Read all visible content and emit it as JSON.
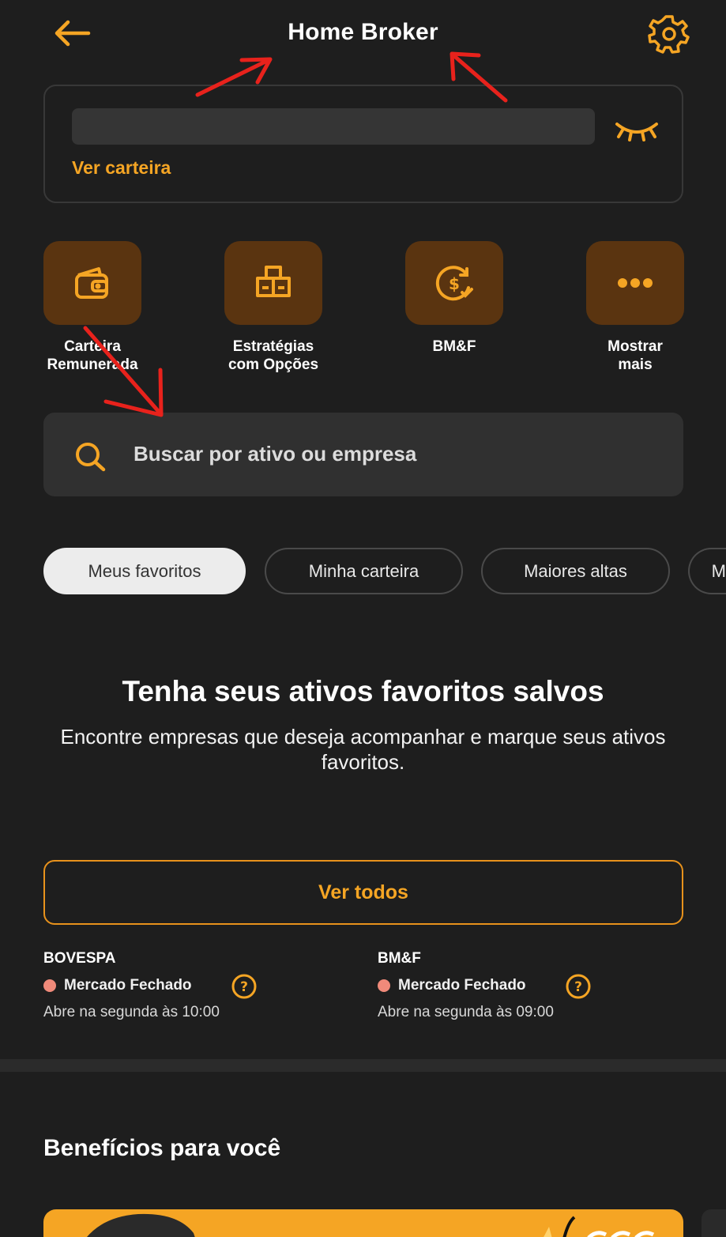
{
  "header": {
    "title": "Home Broker",
    "back_icon": "arrow-left-icon",
    "settings_icon": "gear-icon"
  },
  "balance": {
    "wallet_link": "Ver carteira",
    "visibility_icon": "eye-closed-icon"
  },
  "quick_actions": [
    {
      "icon": "wallet-icon",
      "line1": "Carteira",
      "line2": "Remunerada"
    },
    {
      "icon": "boxes-icon",
      "line1": "Estratégias",
      "line2": "com Opções"
    },
    {
      "icon": "dollar-exchange-icon",
      "line1": "BM&F",
      "line2": ""
    },
    {
      "icon": "more-dots-icon",
      "line1": "Mostrar",
      "line2": "mais"
    }
  ],
  "search": {
    "placeholder": "Buscar por ativo ou empresa"
  },
  "filter_chips": [
    {
      "label": "Meus favoritos",
      "active": true
    },
    {
      "label": "Minha carteira",
      "active": false
    },
    {
      "label": "Maiores altas",
      "active": false
    },
    {
      "label": "M",
      "active": false
    }
  ],
  "empty_state": {
    "title": "Tenha seus ativos favoritos salvos",
    "description": "Encontre empresas que deseja acompanhar e marque seus ativos favoritos."
  },
  "see_all_button": "Ver todos",
  "markets": [
    {
      "name": "BOVESPA",
      "status": "Mercado Fechado",
      "opens": "Abre na segunda às 10:00"
    },
    {
      "name": "BM&F",
      "status": "Mercado Fechado",
      "opens": "Abre na segunda às 09:00"
    }
  ],
  "benefits": {
    "title": "Benefícios para você"
  },
  "colors": {
    "background": "#1e1e1e",
    "accent": "#f5a524",
    "tile": "#5a3410",
    "status_dot": "#f08a7a",
    "annotation_arrow": "#e8221c"
  }
}
